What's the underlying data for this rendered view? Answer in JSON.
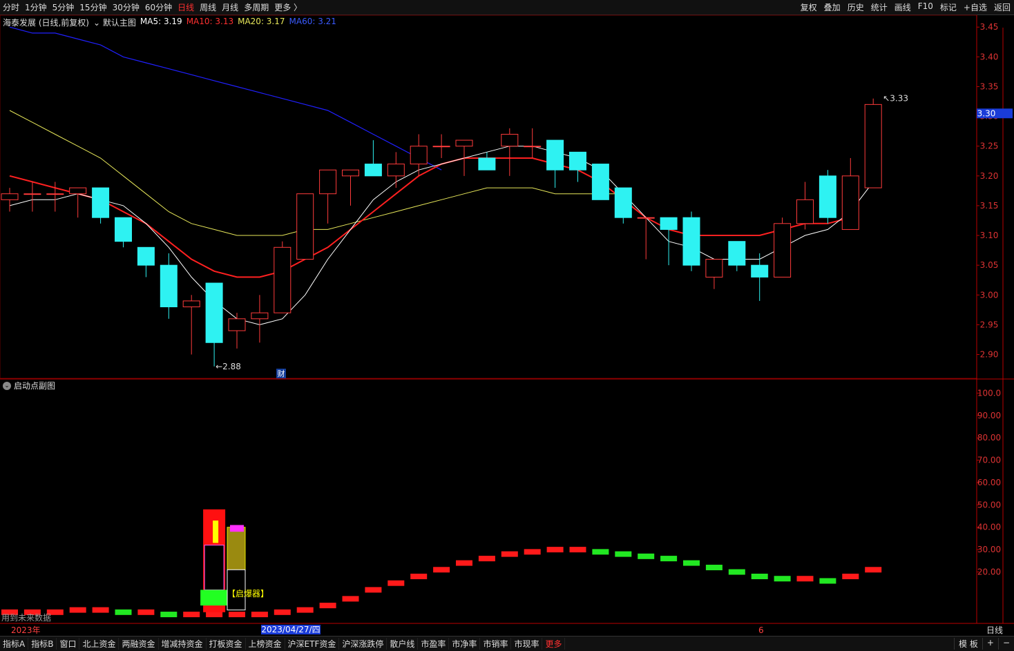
{
  "toolbar": {
    "timeframes": [
      "分时",
      "1分钟",
      "5分钟",
      "15分钟",
      "30分钟",
      "60分钟",
      "日线",
      "周线",
      "月线",
      "多周期",
      "更多 〉"
    ],
    "active": "日线",
    "tools": [
      "复权",
      "叠加",
      "历史",
      "统计",
      "画线",
      "F10",
      "标记",
      "+自选",
      "返回"
    ]
  },
  "legend": {
    "title": "海泰发展 (日线,前复权)",
    "main_chart": "默认主图",
    "ma5": "MA5: 3.19",
    "ma10": "MA10: 3.13",
    "ma20": "MA20: 3.17",
    "ma60": "MA60: 3.21"
  },
  "colors": {
    "up": "#ff3b3b",
    "down": "#2ef2f2",
    "ma5": "#ffffff",
    "ma10": "#ff2020",
    "ma20": "#e8e85a",
    "ma60": "#2020ff"
  },
  "price_axis": [
    "3.45",
    "3.40",
    "3.35",
    "3.30",
    "3.25",
    "3.20",
    "3.15",
    "3.10",
    "3.05",
    "3.00",
    "2.95",
    "2.90"
  ],
  "current_price": "3.30",
  "annotations": {
    "high": "3.33",
    "low": "2.88",
    "fin": "财"
  },
  "sub": {
    "title": "启动点副图",
    "axis": [
      "100.0",
      "90.00",
      "80.00",
      "70.00",
      "60.00",
      "50.00",
      "40.00",
      "30.00",
      "20.00"
    ],
    "signal": "【启爆器】",
    "note": "用到未来数据"
  },
  "timeline": {
    "year": "2023年",
    "cursor_date": "2023/04/27/四",
    "month": "6",
    "period": "日线"
  },
  "chart_data": {
    "type": "candlestick",
    "candles": [
      [
        3.16,
        3.17,
        3.14,
        3.18
      ],
      [
        3.17,
        3.17,
        3.14,
        3.19
      ],
      [
        3.17,
        3.17,
        3.14,
        3.19
      ],
      [
        3.17,
        3.18,
        3.13,
        3.18
      ],
      [
        3.18,
        3.13,
        3.12,
        3.18
      ],
      [
        3.13,
        3.09,
        3.08,
        3.13
      ],
      [
        3.08,
        3.05,
        3.03,
        3.08
      ],
      [
        3.05,
        2.98,
        2.96,
        3.07
      ],
      [
        2.98,
        2.99,
        2.9,
        3.0
      ],
      [
        3.02,
        2.92,
        2.88,
        3.0
      ],
      [
        2.94,
        2.96,
        2.91,
        2.97
      ],
      [
        2.96,
        2.97,
        2.92,
        3.0
      ],
      [
        2.97,
        3.08,
        2.97,
        3.09
      ],
      [
        3.06,
        3.17,
        3.06,
        3.17
      ],
      [
        3.17,
        3.21,
        3.12,
        3.21
      ],
      [
        3.2,
        3.21,
        3.15,
        3.21
      ],
      [
        3.22,
        3.2,
        3.2,
        3.26
      ],
      [
        3.2,
        3.22,
        3.18,
        3.24
      ],
      [
        3.22,
        3.25,
        3.2,
        3.27
      ],
      [
        3.25,
        3.25,
        3.23,
        3.27
      ],
      [
        3.25,
        3.26,
        3.2,
        3.26
      ],
      [
        3.23,
        3.21,
        3.21,
        3.24
      ],
      [
        3.25,
        3.27,
        3.2,
        3.28
      ],
      [
        3.25,
        3.25,
        3.23,
        3.28
      ],
      [
        3.26,
        3.21,
        3.18,
        3.26
      ],
      [
        3.24,
        3.21,
        3.19,
        3.24
      ],
      [
        3.22,
        3.16,
        3.16,
        3.22
      ],
      [
        3.18,
        3.13,
        3.12,
        3.18
      ],
      [
        3.13,
        3.13,
        3.06,
        3.13
      ],
      [
        3.13,
        3.11,
        3.05,
        3.13
      ],
      [
        3.13,
        3.05,
        3.04,
        3.14
      ],
      [
        3.03,
        3.06,
        3.01,
        3.06
      ],
      [
        3.09,
        3.05,
        3.04,
        3.09
      ],
      [
        3.05,
        3.03,
        2.99,
        3.07
      ],
      [
        3.03,
        3.12,
        3.03,
        3.13
      ],
      [
        3.12,
        3.16,
        3.11,
        3.19
      ],
      [
        3.2,
        3.13,
        3.12,
        3.21
      ],
      [
        3.11,
        3.2,
        3.11,
        3.23
      ],
      [
        3.18,
        3.32,
        3.18,
        3.33
      ]
    ],
    "ma5": [
      3.15,
      3.16,
      3.16,
      3.17,
      3.16,
      3.15,
      3.12,
      3.08,
      3.03,
      2.99,
      2.96,
      2.95,
      2.96,
      3.0,
      3.06,
      3.11,
      3.16,
      3.19,
      3.21,
      3.22,
      3.23,
      3.24,
      3.25,
      3.25,
      3.24,
      3.23,
      3.21,
      3.17,
      3.13,
      3.09,
      3.08,
      3.06,
      3.06,
      3.06,
      3.08,
      3.1,
      3.11,
      3.14,
      3.19
    ],
    "ma10": [
      3.2,
      3.19,
      3.18,
      3.17,
      3.16,
      3.14,
      3.12,
      3.09,
      3.06,
      3.04,
      3.03,
      3.03,
      3.04,
      3.06,
      3.08,
      3.11,
      3.14,
      3.17,
      3.2,
      3.22,
      3.23,
      3.23,
      3.23,
      3.23,
      3.22,
      3.21,
      3.19,
      3.16,
      3.13,
      3.11,
      3.1,
      3.1,
      3.1,
      3.1,
      3.11,
      3.12,
      3.12,
      3.13
    ],
    "ma20": [
      3.31,
      3.29,
      3.27,
      3.25,
      3.23,
      3.2,
      3.17,
      3.14,
      3.12,
      3.11,
      3.1,
      3.1,
      3.1,
      3.11,
      3.11,
      3.12,
      3.13,
      3.14,
      3.15,
      3.16,
      3.17,
      3.18,
      3.18,
      3.18,
      3.17,
      3.17,
      3.17,
      3.17
    ],
    "ma60": [
      3.45,
      3.44,
      3.44,
      3.43,
      3.42,
      3.4,
      3.39,
      3.38,
      3.37,
      3.36,
      3.35,
      3.34,
      3.33,
      3.32,
      3.31,
      3.29,
      3.27,
      3.25,
      3.23,
      3.21
    ],
    "sub_values": [
      2,
      2,
      2,
      3,
      3,
      2,
      2,
      1,
      1,
      1,
      1,
      1,
      2,
      3,
      5,
      8,
      12,
      15,
      18,
      21,
      24,
      26,
      28,
      29,
      30,
      30,
      29,
      28,
      27,
      26,
      24,
      22,
      20,
      18,
      17,
      17,
      16,
      18,
      21
    ]
  }
}
